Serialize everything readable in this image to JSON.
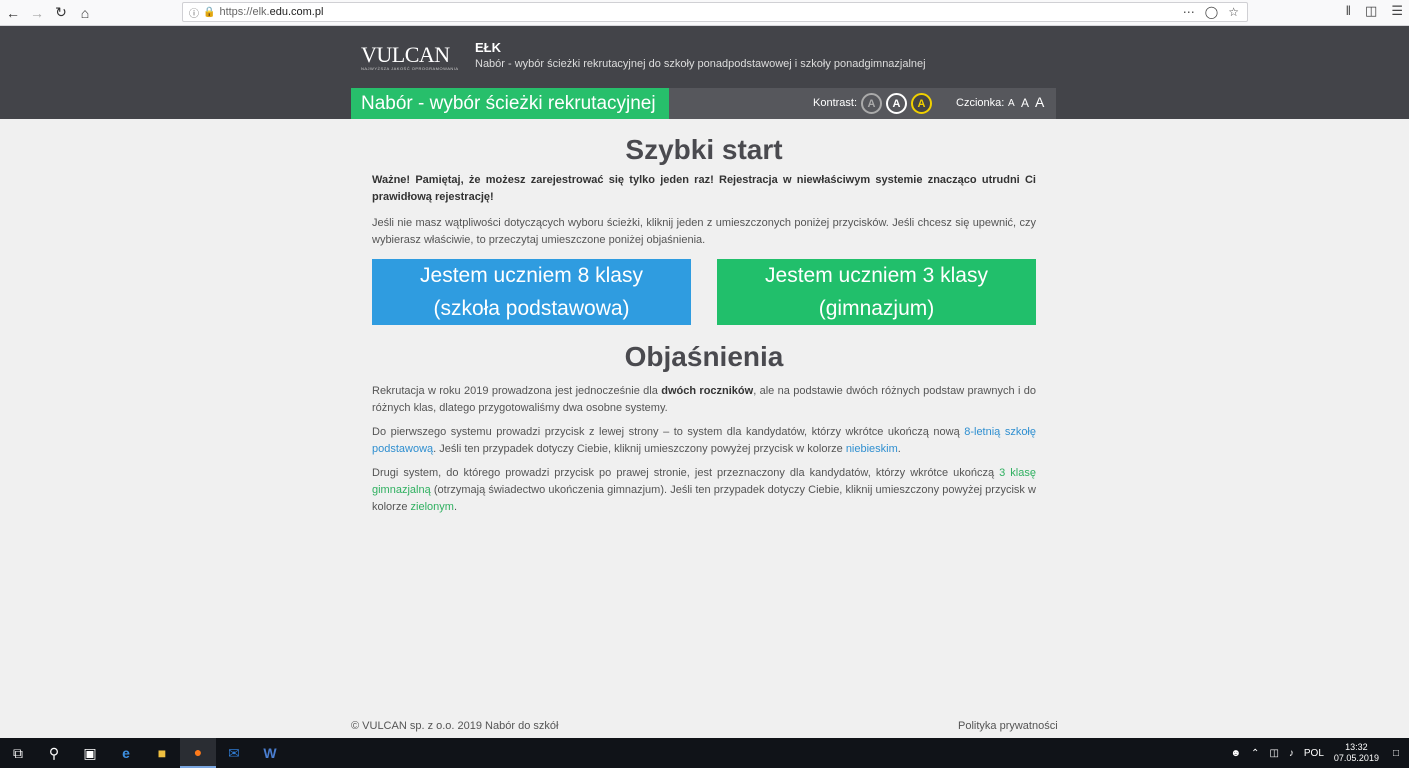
{
  "browser": {
    "url_prefix": "https://elk.",
    "url_domain": "edu.com.pl",
    "back_icon": "back-arrow-icon",
    "forward_icon": "forward-arrow-icon",
    "reload_icon": "reload-icon",
    "home_icon": "home-icon"
  },
  "header": {
    "logo": "VULCAN",
    "logo_tagline": "NAJWYŻSZA JAKOŚĆ OPROGRAMOWANIA",
    "town": "EŁK",
    "subtitle": "Nabór - wybór ścieżki rekrutacyjnej do szkoły ponadpodstawowej i szkoły ponadgimnazjalnej",
    "tab_title": "Nabór - wybór ścieżki rekrutacyjnej",
    "contrast_label": "Kontrast:",
    "contrast_options": [
      "A",
      "A",
      "A"
    ],
    "font_label": "Czcionka:",
    "font_sizes": [
      "A",
      "A",
      "A"
    ]
  },
  "main": {
    "title": "Szybki start",
    "warning": "Ważne! Pamiętaj, że możesz zarejestrować się tylko jeden raz! Rejestracja w niewłaściwym systemie znacząco utrudni Ci prawidłową rejestrację!",
    "intro": "Jeśli nie masz wątpliwości dotyczących wyboru ścieżki, kliknij jeden z umieszczonych poniżej przycisków. Jeśli chcesz się upewnić, czy wybierasz właściwie, to przeczytaj umieszczone poniżej objaśnienia.",
    "btn_primary_line1": "Jestem uczniem 8 klasy",
    "btn_primary_line2": "(szkoła podstawowa)",
    "btn_secondary_line1": "Jestem uczniem 3 klasy",
    "btn_secondary_line2": "(gimnazjum)",
    "explanations_title": "Objaśnienia",
    "p1_a": "Rekrutacja w roku 2019 prowadzona jest jednocześnie dla ",
    "p1_b": "dwóch roczników",
    "p1_c": ", ale na podstawie dwóch różnych podstaw prawnych i do różnych klas, dlatego przygotowaliśmy dwa osobne systemy.",
    "p2_a": "Do pierwszego systemu prowadzi przycisk z lewej strony – to system dla kandydatów, którzy wkrótce ukończą nową ",
    "p2_link": "8-letnią szkołę podstawową",
    "p2_b": ". Jeśli ten przypadek dotyczy Ciebie, kliknij umieszczony powyżej przycisk w kolorze ",
    "p2_color": "niebieskim",
    "p2_c": ".",
    "p3_a": "Drugi system, do którego prowadzi przycisk po prawej stronie, jest przeznaczony dla kandydatów, którzy wkrótce ukończą ",
    "p3_link": "3 klasę gimnazjalną",
    "p3_b": " (otrzymają świadectwo ukończenia gimnazjum). Jeśli ten przypadek dotyczy Ciebie, kliknij umieszczony powyżej przycisk w kolorze ",
    "p3_color": "zielonym",
    "p3_c": "."
  },
  "footer": {
    "copyright": "© VULCAN sp. z o.o. 2019 Nabór do szkół",
    "privacy": "Polityka prywatności"
  },
  "taskbar": {
    "lang": "POL",
    "time": "13:32",
    "date": "07.05.2019"
  },
  "colors": {
    "header_bg": "#434449",
    "green": "#21bf6b",
    "blue": "#2f9ce0"
  }
}
